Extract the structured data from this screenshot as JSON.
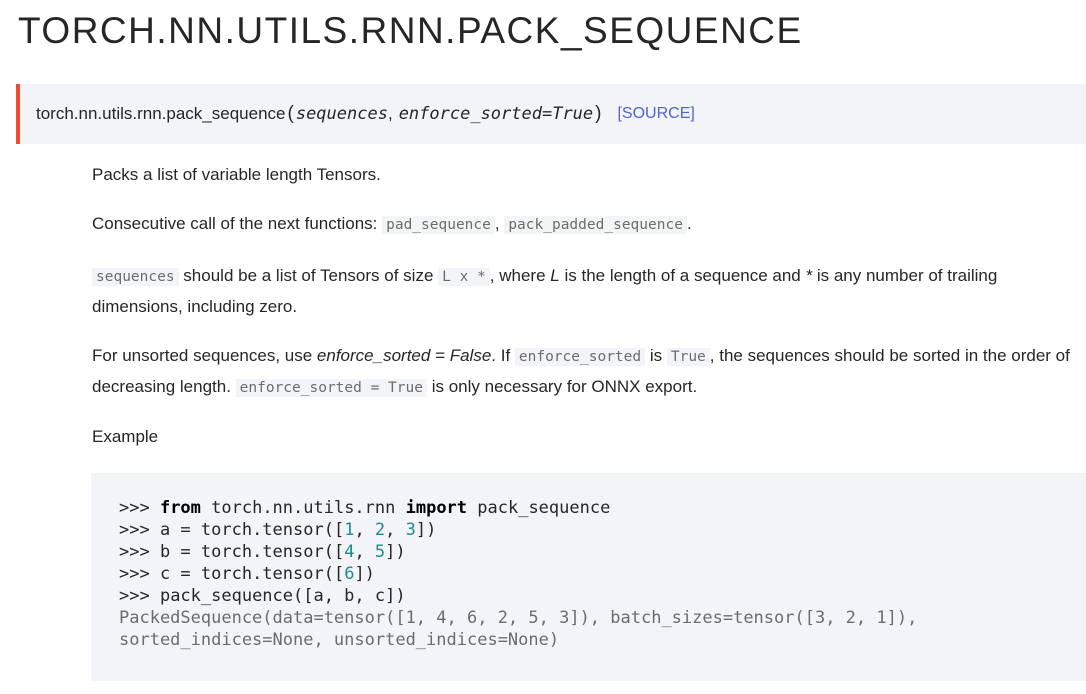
{
  "title": "TORCH.NN.UTILS.RNN.PACK_SEQUENCE",
  "signature": {
    "name": "torch.nn.utils.rnn.pack_sequence",
    "open_paren": "(",
    "param1": "sequences",
    "sep": ",",
    "param2": "enforce_sorted=True",
    "close_paren": ")",
    "source_link": "[SOURCE]"
  },
  "paragraphs": {
    "p1": "Packs a list of variable length Tensors.",
    "p2_text": "Consecutive call of the next functions: ",
    "p2_code1": "pad_sequence",
    "p2_sep": ", ",
    "p2_code2": "pack_padded_sequence",
    "p2_end": ".",
    "p3_code1": "sequences",
    "p3_text1": " should be a list of Tensors of size ",
    "p3_code2": "L x *",
    "p3_text2": ", where ",
    "p3_em1": "L",
    "p3_text3": " is the length of a sequence and ",
    "p3_em2": "*",
    "p3_text4": " is any number of trailing dimensions, including zero.",
    "p4_text1": "For unsorted sequences, use ",
    "p4_em1": "enforce_sorted = False",
    "p4_text2": ". If ",
    "p4_code1": "enforce_sorted",
    "p4_text3": " is ",
    "p4_code2": "True",
    "p4_text4": ", the sequences should be sorted in the order of decreasing length. ",
    "p4_code3": "enforce_sorted = True",
    "p4_text5": " is only necessary for ONNX export.",
    "p5": "Example"
  },
  "code": {
    "line1": {
      "prompt": ">>> ",
      "kw1": "from",
      "mod": " torch.nn.utils.rnn ",
      "kw2": "import",
      "rest": " pack_sequence"
    },
    "line2": {
      "prompt": ">>> ",
      "pre": "a = torch.tensor([",
      "n1": "1",
      "s1": ", ",
      "n2": "2",
      "s2": ", ",
      "n3": "3",
      "post": "])"
    },
    "line3": {
      "prompt": ">>> ",
      "pre": "b = torch.tensor([",
      "n1": "4",
      "s1": ", ",
      "n2": "5",
      "post": "])"
    },
    "line4": {
      "prompt": ">>> ",
      "pre": "c = torch.tensor([",
      "n1": "6",
      "post": "])"
    },
    "line5": {
      "prompt": ">>> ",
      "text": "pack_sequence([a, b, c])"
    },
    "out1": "PackedSequence(data=tensor([1, 4, 6, 2, 5, 3]), batch_sizes=tensor([3, 2, 1]),",
    "out2": "sorted_indices=None, unsorted_indices=None)"
  }
}
